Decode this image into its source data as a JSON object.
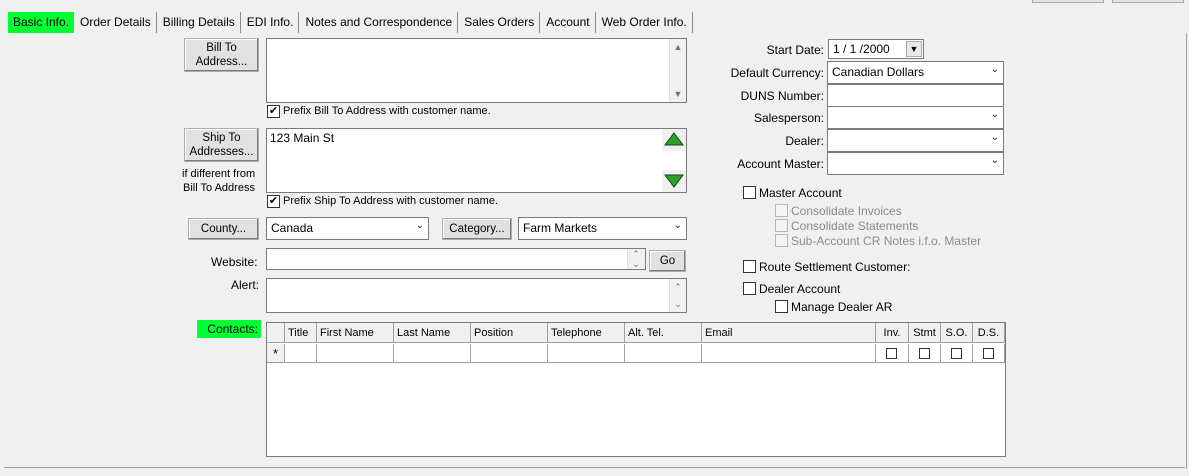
{
  "tabs": [
    {
      "label": "Basic Info."
    },
    {
      "label": "Order Details"
    },
    {
      "label": "Billing Details"
    },
    {
      "label": "EDI Info."
    },
    {
      "label": "Notes and Correspondence"
    },
    {
      "label": "Sales Orders"
    },
    {
      "label": "Account"
    },
    {
      "label": "Web Order Info."
    }
  ],
  "bill_to": {
    "button_line1": "Bill To",
    "button_line2": "Address...",
    "value": "",
    "prefix_checkbox_label": "Prefix Bill To Address with customer name.",
    "prefix_checked": true
  },
  "ship_to": {
    "button_line1": "Ship To",
    "button_line2": "Addresses...",
    "note_line1": "if different from",
    "note_line2": "Bill To Address",
    "value": "123 Main St",
    "prefix_checkbox_label": "Prefix Ship To Address with customer name.",
    "prefix_checked": true
  },
  "county": {
    "button_label": "County...",
    "value": "Canada"
  },
  "category": {
    "button_label": "Category...",
    "value": "Farm Markets"
  },
  "website": {
    "label": "Website:",
    "value": "",
    "go_label": "Go"
  },
  "alert": {
    "label": "Alert:",
    "value": ""
  },
  "right": {
    "start_date_label": "Start Date:",
    "start_date_value": "1 / 1 /2000",
    "currency_label": "Default Currency:",
    "currency_value": "Canadian Dollars",
    "duns_label": "DUNS Number:",
    "duns_value": "",
    "salesperson_label": "Salesperson:",
    "salesperson_value": "",
    "dealer_label": "Dealer:",
    "dealer_value": "",
    "account_master_label": "Account Master:",
    "account_master_value": "",
    "master_account_label": "Master Account",
    "consolidate_invoices_label": "Consolidate Invoices",
    "consolidate_statements_label": "Consolidate Statements",
    "subaccount_label": "Sub-Account CR Notes i.f.o. Master",
    "route_settlement_label": "Route Settlement Customer:",
    "dealer_account_label": "Dealer Account",
    "manage_dealer_ar_label": "Manage Dealer AR"
  },
  "contacts": {
    "label": "Contacts:",
    "new_row_marker": "*",
    "columns": [
      "Title",
      "First Name",
      "Last Name",
      "Position",
      "Telephone",
      "Alt. Tel.",
      "Email",
      "Inv.",
      "Stmt",
      "S.O.",
      "D.S."
    ]
  },
  "colors": {
    "accent_green": "#00ff33",
    "background": "#f0f0f0",
    "arrow_green": "#2e9e2e"
  }
}
